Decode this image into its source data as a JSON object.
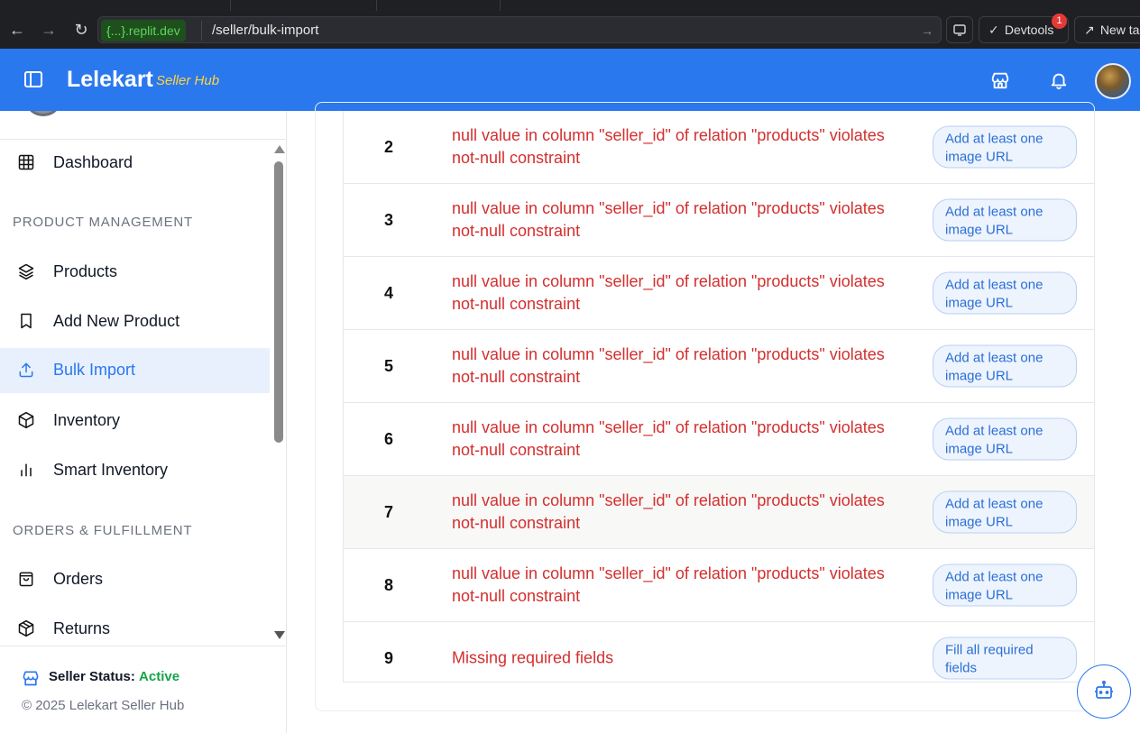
{
  "browser": {
    "url_host_prefix": "{...}",
    "url_host_rest": ".replit.dev",
    "url_path": "/seller/bulk-import",
    "devtools_label": "Devtools",
    "devtools_badge": "1",
    "new_tab_label": "New ta"
  },
  "header": {
    "brand": "Lelekart",
    "brand_sub": "Seller Hub"
  },
  "sidebar": {
    "items": [
      {
        "label": "Dashboard",
        "icon": "grid-icon"
      },
      {
        "label": "Products",
        "icon": "layers-icon"
      },
      {
        "label": "Add New Product",
        "icon": "bookmark-icon"
      },
      {
        "label": "Bulk Import",
        "icon": "upload-icon",
        "active": true
      },
      {
        "label": "Inventory",
        "icon": "box-icon"
      },
      {
        "label": "Smart Inventory",
        "icon": "bar-chart-icon"
      },
      {
        "label": "Orders",
        "icon": "shopping-bag-icon"
      },
      {
        "label": "Returns",
        "icon": "package-return-icon"
      }
    ],
    "sections": {
      "product_management": "PRODUCT MANAGEMENT",
      "orders_fulfillment": "ORDERS & FULFILLMENT"
    },
    "footer": {
      "status_label": "Seller Status:",
      "status_value": "Active",
      "copyright": "© 2025 Lelekart Seller Hub"
    }
  },
  "errors_table": {
    "rows": [
      {
        "row": "2",
        "error": "null value in column \"seller_id\" of relation \"products\" violates not-null constraint",
        "fix": "Add at least one image URL"
      },
      {
        "row": "3",
        "error": "null value in column \"seller_id\" of relation \"products\" violates not-null constraint",
        "fix": "Add at least one image URL"
      },
      {
        "row": "4",
        "error": "null value in column \"seller_id\" of relation \"products\" violates not-null constraint",
        "fix": "Add at least one image URL"
      },
      {
        "row": "5",
        "error": "null value in column \"seller_id\" of relation \"products\" violates not-null constraint",
        "fix": "Add at least one image URL"
      },
      {
        "row": "6",
        "error": "null value in column \"seller_id\" of relation \"products\" violates not-null constraint",
        "fix": "Add at least one image URL"
      },
      {
        "row": "7",
        "error": "null value in column \"seller_id\" of relation \"products\" violates not-null constraint",
        "fix": "Add at least one image URL"
      },
      {
        "row": "8",
        "error": "null value in column \"seller_id\" of relation \"products\" violates not-null constraint",
        "fix": "Add at least one image URL"
      },
      {
        "row": "9",
        "error": "Missing required fields",
        "fix": "Fill all required fields"
      }
    ]
  },
  "colors": {
    "brand_blue": "#2a78ee",
    "error_red": "#d32f2f",
    "active_green": "#16a34a",
    "accent_yellow": "#ffd53d"
  }
}
